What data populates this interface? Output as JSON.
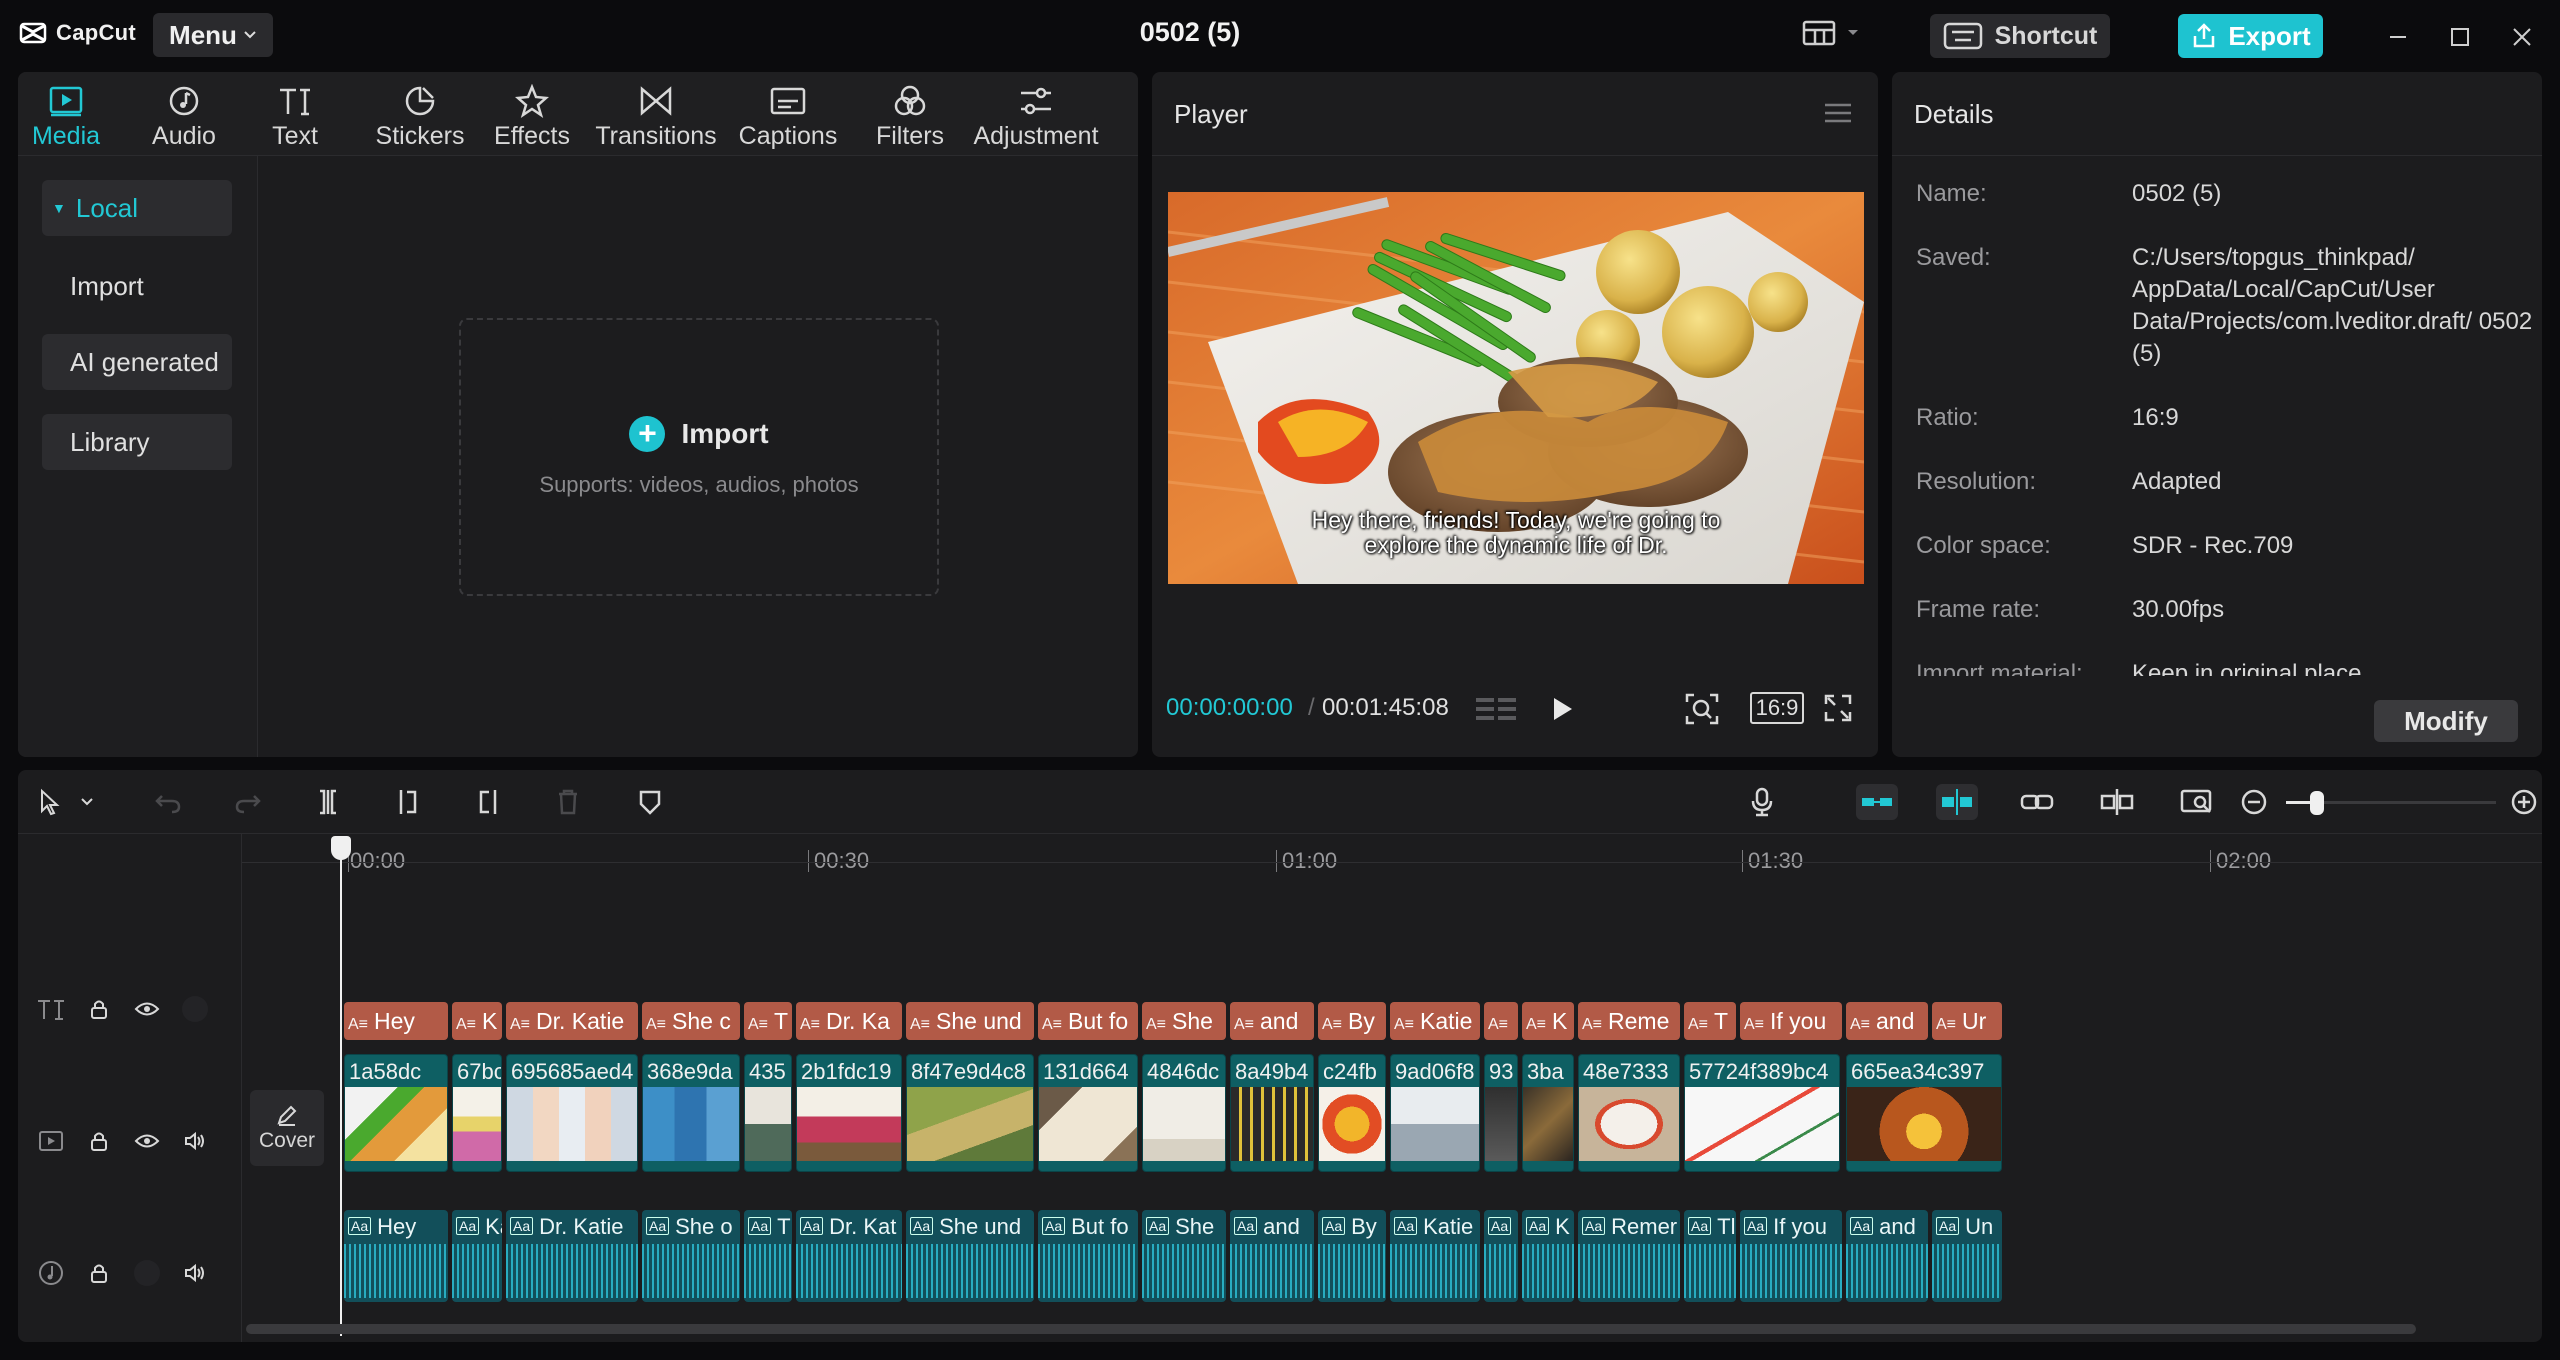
{
  "app": {
    "logo_text": "CapCut",
    "menu_label": "Menu",
    "project_title": "0502 (5)",
    "shortcut_label": "Shortcut",
    "export_label": "Export",
    "accent_color": "#1ec3d0"
  },
  "tools": [
    {
      "label": "Media",
      "icon": "media-icon"
    },
    {
      "label": "Audio",
      "icon": "audio-icon"
    },
    {
      "label": "Text",
      "icon": "text-icon"
    },
    {
      "label": "Stickers",
      "icon": "stickers-icon"
    },
    {
      "label": "Effects",
      "icon": "effects-icon"
    },
    {
      "label": "Transitions",
      "icon": "transitions-icon"
    },
    {
      "label": "Captions",
      "icon": "captions-icon"
    },
    {
      "label": "Filters",
      "icon": "filters-icon"
    },
    {
      "label": "Adjustment",
      "icon": "adjustment-icon"
    }
  ],
  "sidebar": {
    "local": "Local",
    "import": "Import",
    "ai_generated": "AI generated",
    "library": "Library"
  },
  "media_area": {
    "import_label": "Import",
    "import_hint": "Supports: videos, audios, photos"
  },
  "player": {
    "title": "Player",
    "subtitle_line1": "Hey there, friends! Today, we're going to",
    "subtitle_line2": "explore the dynamic life of Dr.",
    "current_time": "00:00:00:00",
    "separator": "/",
    "total_time": "00:01:45:08",
    "ratio_label": "16:9"
  },
  "details": {
    "title": "Details",
    "rows": [
      {
        "label": "Name:",
        "value": "0502 (5)"
      },
      {
        "label": "Saved:",
        "value": "C:/Users/topgus_thinkpad/ AppData/Local/CapCut/User Data/Projects/com.lveditor.draft/ 0502 (5)"
      },
      {
        "label": "Ratio:",
        "value": "16:9"
      },
      {
        "label": "Resolution:",
        "value": "Adapted"
      },
      {
        "label": "Color space:",
        "value": "SDR - Rec.709"
      },
      {
        "label": "Frame rate:",
        "value": "30.00fps"
      },
      {
        "label": "Import material:",
        "value": "Keep in original place"
      }
    ],
    "modify_label": "Modify"
  },
  "timeline": {
    "ruler": [
      "00:00",
      "00:30",
      "01:00",
      "01:30",
      "02:00"
    ],
    "cover_label": "Cover",
    "text_clips": [
      "Hey",
      "K",
      "Dr. Katie",
      "She c",
      "T",
      "Dr. Ka",
      "She und",
      "But fo",
      "She",
      "and",
      "By",
      "Katie",
      "",
      "K",
      "Reme",
      "T",
      "If you",
      "and",
      "Ur"
    ],
    "video_clips": [
      "1a58dc",
      "67bc",
      "695685aed4",
      "368e9da",
      "435",
      "2b1fdc19",
      "8f47e9d4c8",
      "131d664",
      "4846dc",
      "8a49b4",
      "c24fb",
      "9ad06f8",
      "93",
      "3ba",
      "48e7333",
      "57724f389bc4",
      "665ea34c397"
    ],
    "audio_clips": [
      "Hey",
      "Ka",
      "Dr. Katie",
      "She o",
      "T",
      "Dr. Kat",
      "She und",
      "But fo",
      "She",
      "and",
      "By",
      "Katie",
      "",
      "K",
      "Remer",
      "Tl",
      "If you",
      "and",
      "Un"
    ]
  }
}
